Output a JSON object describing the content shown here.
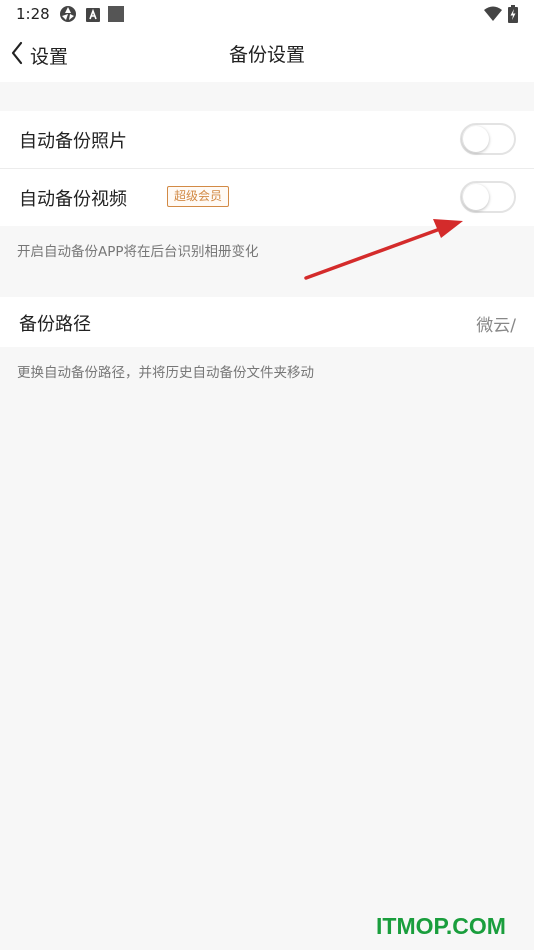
{
  "status_bar": {
    "time": "1:28"
  },
  "nav": {
    "back_label": "设置",
    "title": "备份设置"
  },
  "settings": {
    "auto_backup_photos": {
      "label": "自动备份照片",
      "enabled": false
    },
    "auto_backup_videos": {
      "label": "自动备份视频",
      "badge": "超级会员",
      "enabled": false
    },
    "auto_backup_hint": "开启自动备份APP将在后台识别相册变化",
    "backup_path": {
      "label": "备份路径",
      "value": "微云/"
    },
    "backup_path_hint": "更换自动备份路径，并将历史自动备份文件夹移动"
  },
  "annotation": {
    "arrow_color": "#d42b2b"
  },
  "watermark": "ITMOP.COM",
  "colors": {
    "badge": "#d28a45",
    "watermark": "#1a9e3d"
  }
}
